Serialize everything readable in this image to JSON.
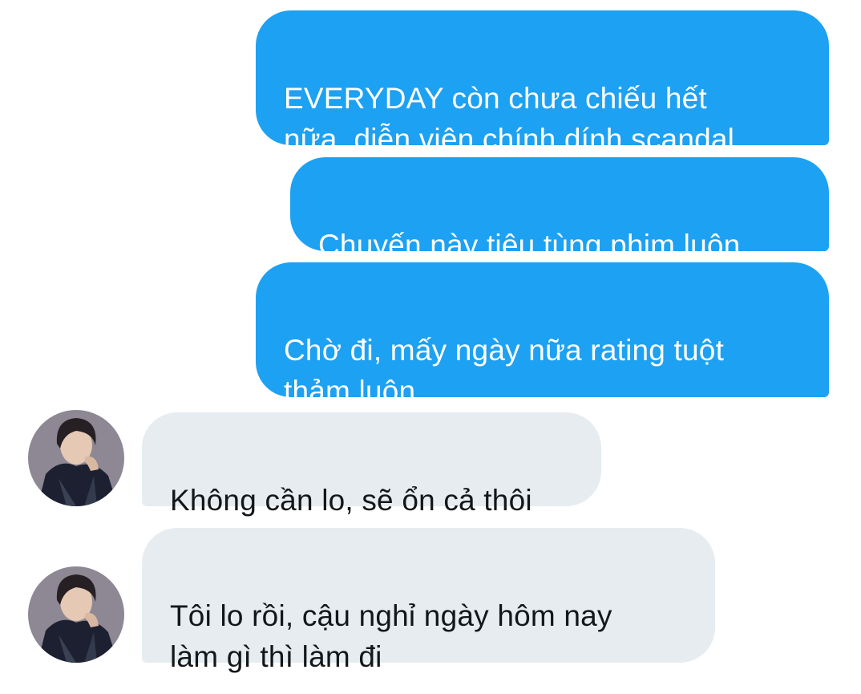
{
  "messages": [
    {
      "direction": "outgoing",
      "text": "EVERYDAY còn chưa chiếu hết\nnữa, diễn viên chính dính scandal"
    },
    {
      "direction": "outgoing",
      "text": "Chuyến này tiêu tùng phim luôn"
    },
    {
      "direction": "outgoing",
      "text": "Chờ đi, mấy ngày nữa rating tuột\nthảm luôn"
    },
    {
      "direction": "incoming",
      "text": "Không cần lo, sẽ ổn cả thôi",
      "avatar": "profile-avatar"
    },
    {
      "direction": "incoming",
      "text": "Tôi lo rồi, cậu nghỉ ngày hôm nay\nlàm gì thì làm đi",
      "avatar": "profile-avatar"
    }
  ],
  "colors": {
    "outgoing_bubble": "#1da1f2",
    "incoming_bubble": "#e6ecf0",
    "outgoing_text": "#ffffff",
    "incoming_text": "#14171a"
  }
}
